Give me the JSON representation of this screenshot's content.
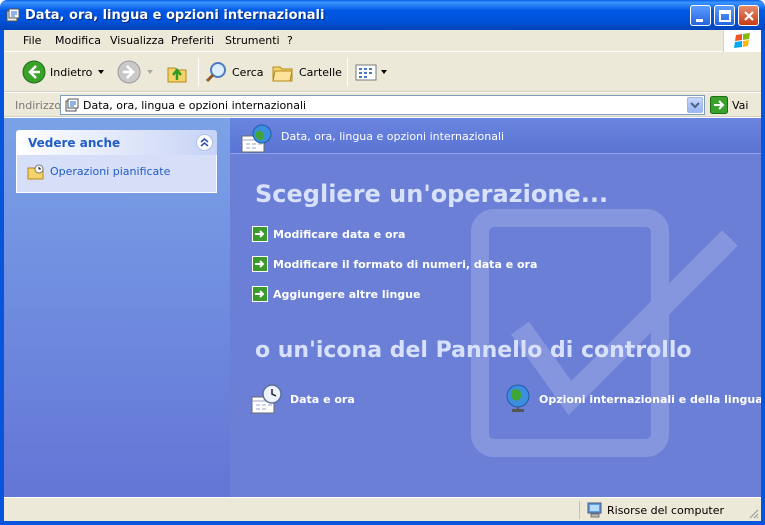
{
  "window": {
    "title": "Data, ora, lingua e opzioni internazionali",
    "title_icon": "control-panel-icon"
  },
  "menu": [
    "File",
    "Modifica",
    "Visualizza",
    "Preferiti",
    "Strumenti",
    "?"
  ],
  "toolbar": {
    "back_label": "Indietro",
    "search_label": "Cerca",
    "folders_label": "Cartelle"
  },
  "address": {
    "label": "Indirizzo",
    "value": "Data, ora, lingua e opzioni internazionali",
    "go_label": "Vai"
  },
  "sidebar": {
    "panel_title": "Vedere anche",
    "links": [
      {
        "label": "Operazioni pianificate",
        "icon": "scheduled-tasks-icon"
      }
    ]
  },
  "main": {
    "header_title": "Data, ora, lingua e opzioni internazionali",
    "pick_task": "Scegliere un'operazione...",
    "tasks": [
      "Modificare data e ora",
      "Modificare il formato di numeri, data e ora",
      "Aggiungere altre lingue"
    ],
    "or_pick_icon": "o un'icona del Pannello di controllo",
    "icons": [
      {
        "label": "Data e ora",
        "icon": "date-time-icon"
      },
      {
        "label": "Opzioni internazionali e della lingua",
        "icon": "globe-icon"
      }
    ]
  },
  "status": {
    "zone": "Risorse del computer"
  },
  "colors": {
    "titlebar": "#0058e6",
    "content_bg": "#6b7fd7",
    "sidebar_bg": "#7ba2e7",
    "task_arrow": "#3a9a2a"
  }
}
